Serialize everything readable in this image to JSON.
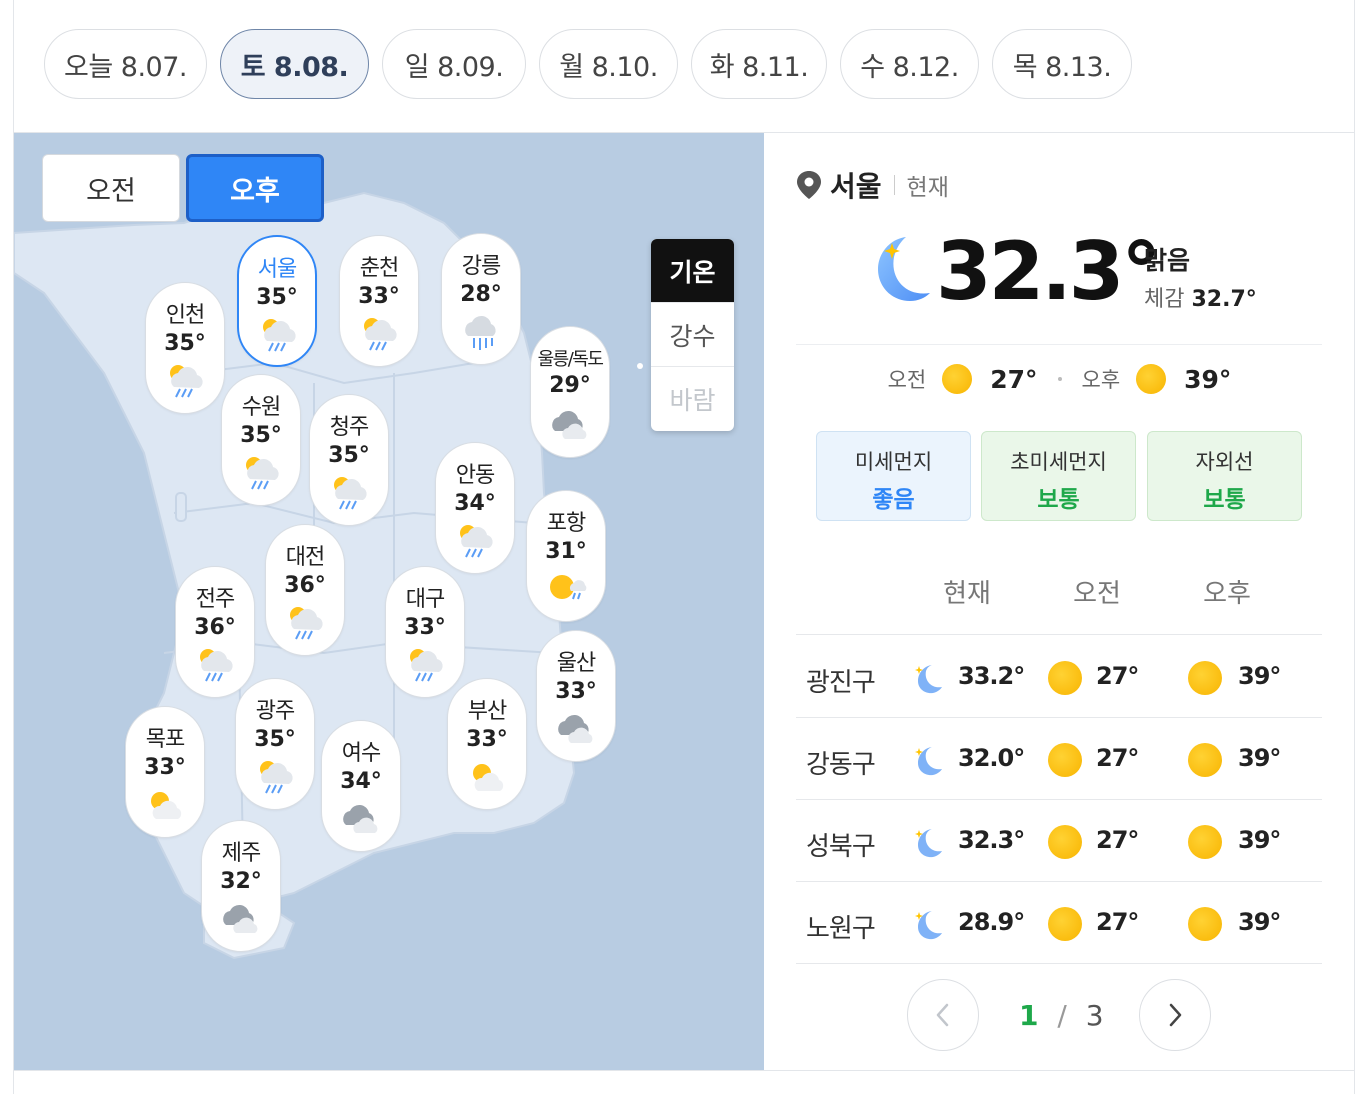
{
  "date_tabs": [
    {
      "label": "오늘 8.07."
    },
    {
      "label": "토 8.08."
    },
    {
      "label": "일 8.09."
    },
    {
      "label": "월 8.10."
    },
    {
      "label": "화 8.11."
    },
    {
      "label": "수 8.12."
    },
    {
      "label": "목 8.13."
    }
  ],
  "active_date_index": 1,
  "map": {
    "am_label": "오전",
    "pm_label": "오후",
    "layers": [
      "기온",
      "강수",
      "바람"
    ],
    "cities": [
      {
        "name": "서울",
        "temp": "35°",
        "icon": "sun-cloud-rain-icon",
        "selected": true
      },
      {
        "name": "춘천",
        "temp": "33°",
        "icon": "sun-cloud-rain-icon"
      },
      {
        "name": "강릉",
        "temp": "28°",
        "icon": "cloud-rain-icon"
      },
      {
        "name": "인천",
        "temp": "35°",
        "icon": "sun-cloud-rain-icon"
      },
      {
        "name": "울릉/독도",
        "temp": "29°",
        "icon": "cloudy-icon"
      },
      {
        "name": "수원",
        "temp": "35°",
        "icon": "sun-cloud-rain-icon"
      },
      {
        "name": "청주",
        "temp": "35°",
        "icon": "sun-cloud-rain-icon"
      },
      {
        "name": "안동",
        "temp": "34°",
        "icon": "sun-cloud-rain-icon"
      },
      {
        "name": "포항",
        "temp": "31°",
        "icon": "sun-rain-icon"
      },
      {
        "name": "대전",
        "temp": "36°",
        "icon": "sun-cloud-rain-icon"
      },
      {
        "name": "전주",
        "temp": "36°",
        "icon": "sun-cloud-rain-icon"
      },
      {
        "name": "대구",
        "temp": "33°",
        "icon": "sun-cloud-rain-icon"
      },
      {
        "name": "울산",
        "temp": "33°",
        "icon": "cloudy-icon"
      },
      {
        "name": "광주",
        "temp": "35°",
        "icon": "sun-cloud-rain-icon"
      },
      {
        "name": "부산",
        "temp": "33°",
        "icon": "partly-cloudy-icon"
      },
      {
        "name": "목포",
        "temp": "33°",
        "icon": "partly-cloudy-icon"
      },
      {
        "name": "여수",
        "temp": "34°",
        "icon": "cloudy-icon"
      },
      {
        "name": "제주",
        "temp": "32°",
        "icon": "cloudy-icon"
      }
    ]
  },
  "current": {
    "location": "서울",
    "now_label": "현재",
    "temp": "32.3°",
    "condition": "맑음",
    "feels_label": "체감",
    "feels_value": "32.7°",
    "am_label": "오전",
    "am_temp": "27°",
    "pm_label": "오후",
    "pm_temp": "39°",
    "icon": "moon-star-icon"
  },
  "air": [
    {
      "title": "미세먼지",
      "value": "좋음",
      "color": "#2f86f6"
    },
    {
      "title": "초미세먼지",
      "value": "보통",
      "color": "#1ea84a"
    },
    {
      "title": "자외선",
      "value": "보통",
      "color": "#1ea84a"
    }
  ],
  "table": {
    "headers": [
      "현재",
      "오전",
      "오후"
    ],
    "rows": [
      {
        "district": "광진구",
        "now": "33.2°",
        "am": "27°",
        "pm": "39°"
      },
      {
        "district": "강동구",
        "now": "32.0°",
        "am": "27°",
        "pm": "39°"
      },
      {
        "district": "성북구",
        "now": "32.3°",
        "am": "27°",
        "pm": "39°"
      },
      {
        "district": "노원구",
        "now": "28.9°",
        "am": "27°",
        "pm": "39°"
      }
    ]
  },
  "pagination": {
    "current": "1",
    "separator": "/",
    "total": "3"
  }
}
